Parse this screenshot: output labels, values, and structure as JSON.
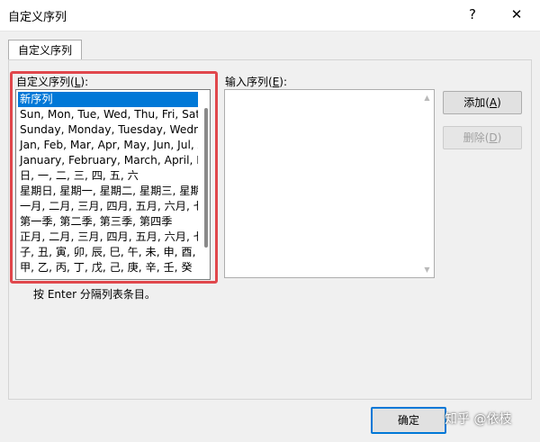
{
  "window": {
    "title": "自定义序列",
    "help_glyph": "?",
    "close_glyph": "✕"
  },
  "tab": {
    "label": "自定义序列"
  },
  "custom_lists": {
    "label": "自定义序列",
    "accesskey": "L",
    "items": [
      "新序列",
      "Sun, Mon, Tue, Wed, Thu, Fri, Sat",
      "Sunday, Monday, Tuesday, Wednesday",
      "Jan, Feb, Mar, Apr, May, Jun, Jul, Aug",
      "January, February, March, April, May",
      "日, 一, 二, 三, 四, 五, 六",
      "星期日, 星期一, 星期二, 星期三, 星期四",
      "一月, 二月, 三月, 四月, 五月, 六月, 七月",
      "第一季, 第二季, 第三季, 第四季",
      "正月, 二月, 三月, 四月, 五月, 六月, 七月",
      "子, 丑, 寅, 卯, 辰, 巳, 午, 未, 申, 酉, 戌",
      "甲, 乙, 丙, 丁, 戊, 己, 庚, 辛, 壬, 癸"
    ],
    "selected_index": 0
  },
  "list_entries": {
    "label": "输入序列",
    "accesskey": "E",
    "value": ""
  },
  "buttons": {
    "add_label": "添加",
    "add_accesskey": "A",
    "delete_label": "删除",
    "delete_accesskey": "D",
    "ok_label": "确定"
  },
  "hint": {
    "text": "按 Enter 分隔列表条目。"
  },
  "watermark": {
    "text": "知乎 @依枝"
  },
  "colors": {
    "selection": "#0078d7",
    "annotation_border": "#e0474c"
  }
}
